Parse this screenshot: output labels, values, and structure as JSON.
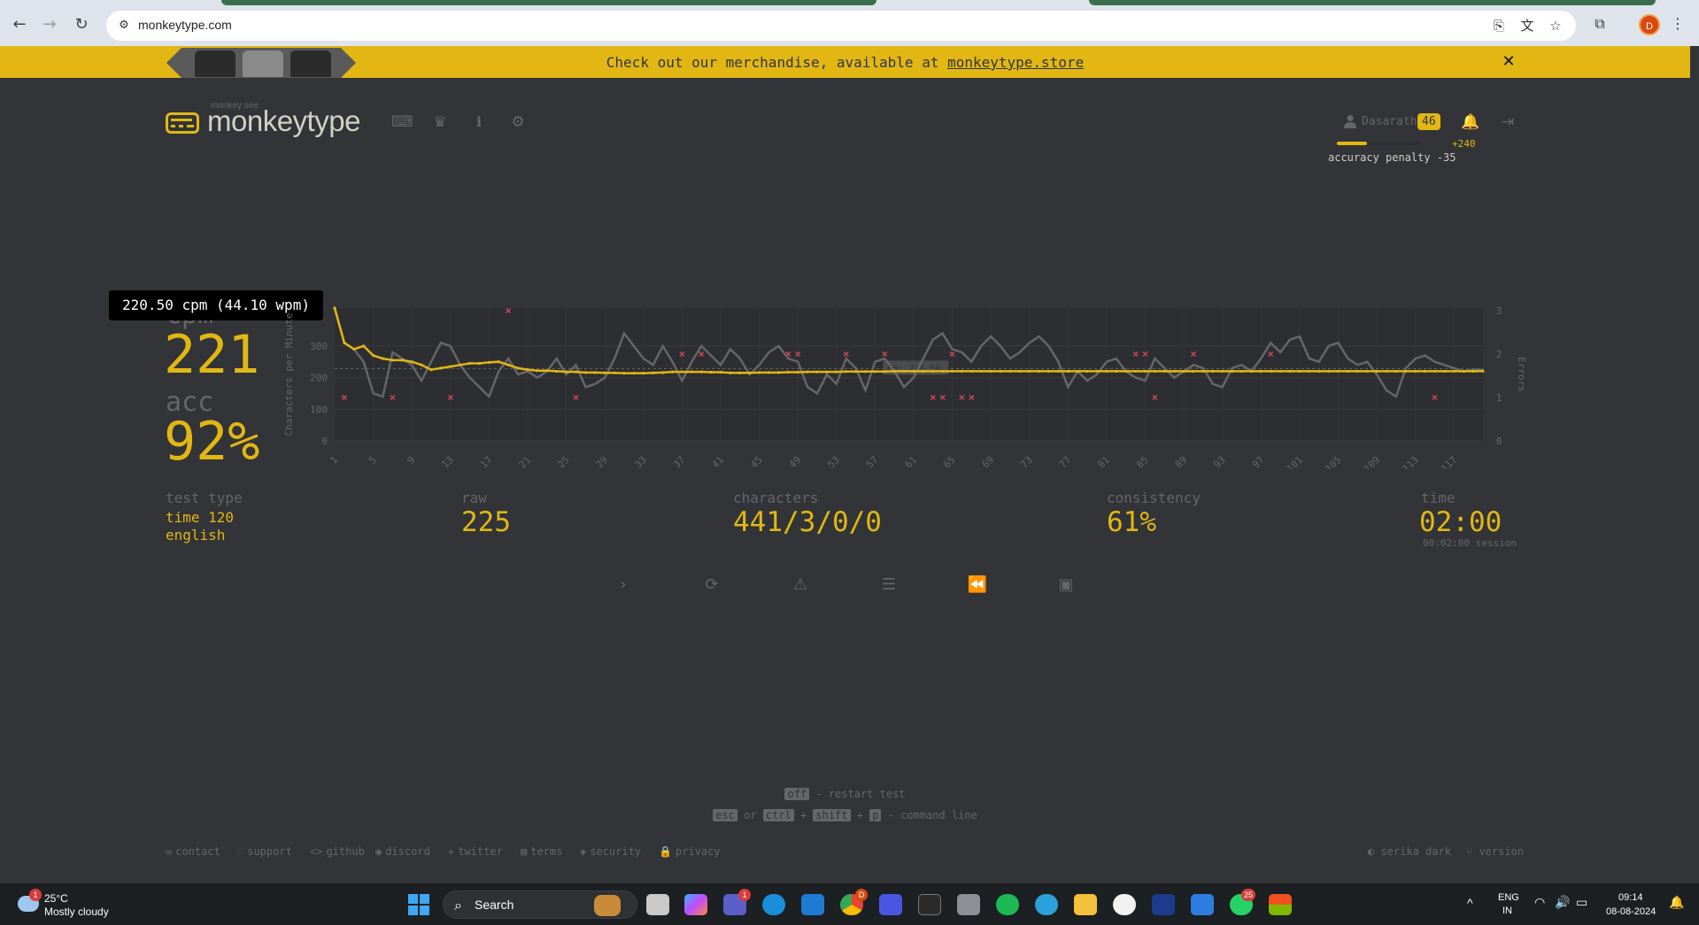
{
  "browser": {
    "url": "monkeytype.com",
    "profile_initial": "D"
  },
  "banner": {
    "text": "Check out our merchandise, available at ",
    "link": "monkeytype.store",
    "close_icon": "close-icon"
  },
  "header": {
    "logo_sub": "monkey see",
    "logo_text": "monkeytype",
    "username": "Dasarath",
    "level": "46",
    "xp_fraction": 0.36,
    "xp_gain": "+240",
    "penalty": "accuracy penalty -35"
  },
  "tooltip": "220.50 cpm (44.10 wpm)",
  "result": {
    "wpm_label": "cpm",
    "wpm_value": "221",
    "acc_label": "acc",
    "acc_value": "92%",
    "test_type_label": "test type",
    "test_type_line1": "time 120",
    "test_type_line2": "english",
    "raw_label": "raw",
    "raw_value": "225",
    "chars_label": "characters",
    "chars_value": "441/3/0/0",
    "consistency_label": "consistency",
    "consistency_value": "61%",
    "time_label": "time",
    "time_value": "02:00",
    "session": "00:02:00 session"
  },
  "chart_data": {
    "type": "line",
    "ylabel": "Characters per Minute",
    "y2label": "Errors",
    "ylim": [
      0,
      420
    ],
    "y_ticks": [
      "0",
      "100",
      "200",
      "300"
    ],
    "y2_ticks": [
      "0",
      "1",
      "2",
      "3"
    ],
    "x_ticks": [
      "1",
      "5",
      "9",
      "13",
      "17",
      "21",
      "25",
      "29",
      "33",
      "37",
      "41",
      "45",
      "49",
      "53",
      "57",
      "61",
      "65",
      "69",
      "73",
      "77",
      "81",
      "85",
      "89",
      "93",
      "97",
      "101",
      "105",
      "109",
      "113",
      "117"
    ],
    "pb_label": "PB: 228.50",
    "pb_value": 228.5,
    "x_count": 120,
    "series": [
      {
        "name": "cpm",
        "color": "#e2b714",
        "values": [
          420,
          310,
          290,
          300,
          270,
          260,
          255,
          255,
          250,
          240,
          225,
          230,
          235,
          240,
          245,
          245,
          248,
          250,
          240,
          230,
          225,
          222,
          222,
          220,
          218,
          218,
          216,
          216,
          215,
          215,
          214,
          214,
          214,
          215,
          216,
          218,
          218,
          218,
          218,
          217,
          217,
          215,
          215,
          215,
          216,
          216,
          216,
          217,
          217,
          218,
          218,
          218,
          218,
          219,
          219,
          219,
          219,
          219,
          220,
          220,
          220,
          220,
          220,
          220,
          220,
          220,
          220,
          220,
          220,
          220,
          220,
          220,
          220,
          220,
          220,
          220,
          220,
          220,
          220,
          220,
          220,
          220,
          220,
          220,
          220,
          220,
          220,
          220,
          220,
          220,
          220,
          220,
          220,
          220,
          220,
          220,
          220,
          220,
          220,
          220,
          220,
          220,
          220,
          220,
          220,
          220,
          220,
          220,
          220,
          220,
          220,
          220,
          220,
          220,
          220,
          220,
          220,
          220,
          220,
          220.5
        ]
      },
      {
        "name": "raw",
        "color": "#646669",
        "values": [
          420,
          310,
          290,
          250,
          150,
          140,
          280,
          260,
          240,
          190,
          250,
          310,
          300,
          240,
          200,
          170,
          140,
          220,
          260,
          210,
          220,
          200,
          220,
          260,
          210,
          240,
          170,
          180,
          200,
          260,
          340,
          300,
          260,
          240,
          300,
          250,
          190,
          250,
          300,
          270,
          240,
          290,
          260,
          210,
          240,
          280,
          300,
          260,
          250,
          170,
          150,
          210,
          180,
          260,
          230,
          160,
          250,
          260,
          220,
          170,
          200,
          260,
          320,
          340,
          290,
          280,
          250,
          300,
          330,
          300,
          260,
          280,
          310,
          330,
          300,
          250,
          170,
          220,
          190,
          210,
          250,
          260,
          220,
          200,
          190,
          260,
          230,
          200,
          220,
          240,
          230,
          180,
          170,
          230,
          240,
          220,
          260,
          310,
          280,
          320,
          330,
          260,
          250,
          300,
          310,
          260,
          240,
          250,
          210,
          160,
          140,
          230,
          260,
          270,
          250,
          240,
          230,
          220,
          225,
          225
        ]
      },
      {
        "name": "errors",
        "color": "#ca4754",
        "points": [
          [
            2,
            1
          ],
          [
            7,
            1
          ],
          [
            13,
            1
          ],
          [
            19,
            3
          ],
          [
            26,
            1
          ],
          [
            37,
            2
          ],
          [
            39,
            2
          ],
          [
            48,
            2
          ],
          [
            49,
            2
          ],
          [
            54,
            2
          ],
          [
            58,
            2
          ],
          [
            63,
            1
          ],
          [
            64,
            1
          ],
          [
            65,
            2
          ],
          [
            66,
            1
          ],
          [
            67,
            1
          ],
          [
            84,
            2
          ],
          [
            85,
            2
          ],
          [
            86,
            1
          ],
          [
            90,
            2
          ],
          [
            98,
            2
          ],
          [
            115,
            1
          ]
        ]
      }
    ]
  },
  "actions": [
    {
      "name": "next-test-button",
      "icon": "chevron-right-icon",
      "glyph": "›"
    },
    {
      "name": "restart-button",
      "icon": "refresh-icon",
      "glyph": "⟳"
    },
    {
      "name": "practice-mistakes-button",
      "icon": "warning-icon",
      "glyph": "⚠"
    },
    {
      "name": "show-words-button",
      "icon": "align-left-icon",
      "glyph": "☰"
    },
    {
      "name": "replay-button",
      "icon": "rewind-icon",
      "glyph": "⏪"
    },
    {
      "name": "screenshot-button",
      "icon": "image-icon",
      "glyph": "▣"
    }
  ],
  "hints": {
    "restart_key": "off",
    "restart_text": " - restart test",
    "esc_key": "esc",
    "or": " or ",
    "ctrl_key": "ctrl",
    "plus": "+",
    "shift_key": "shift",
    "p_key": "p",
    "command_text": " - command line"
  },
  "footer": {
    "links": [
      {
        "name": "contact",
        "icon": "✉",
        "label": "contact"
      },
      {
        "name": "support",
        "icon": "♡",
        "label": "support"
      },
      {
        "name": "github",
        "icon": "<>",
        "label": "github"
      },
      {
        "name": "discord",
        "icon": "◉",
        "label": "discord"
      },
      {
        "name": "twitter",
        "icon": "✈",
        "label": "twitter"
      },
      {
        "name": "terms",
        "icon": "▤",
        "label": "terms"
      },
      {
        "name": "security",
        "icon": "◈",
        "label": "security"
      },
      {
        "name": "privacy",
        "icon": "🔒",
        "label": "privacy"
      }
    ],
    "theme": "serika dark",
    "version": "version"
  },
  "taskbar": {
    "weather_temp": "25°C",
    "weather_desc": "Mostly cloudy",
    "weather_badge": "1",
    "search": "Search",
    "teams_badge": "1",
    "chrome_badge": "D",
    "whatsapp_badge": "25",
    "lang1": "ENG",
    "lang2": "IN",
    "time": "09:14",
    "date": "08-08-2024"
  },
  "colors": {
    "bg": "#323437",
    "main": "#e2b714",
    "sub": "#646669",
    "text": "#d1d0c5",
    "error": "#ca4754"
  }
}
